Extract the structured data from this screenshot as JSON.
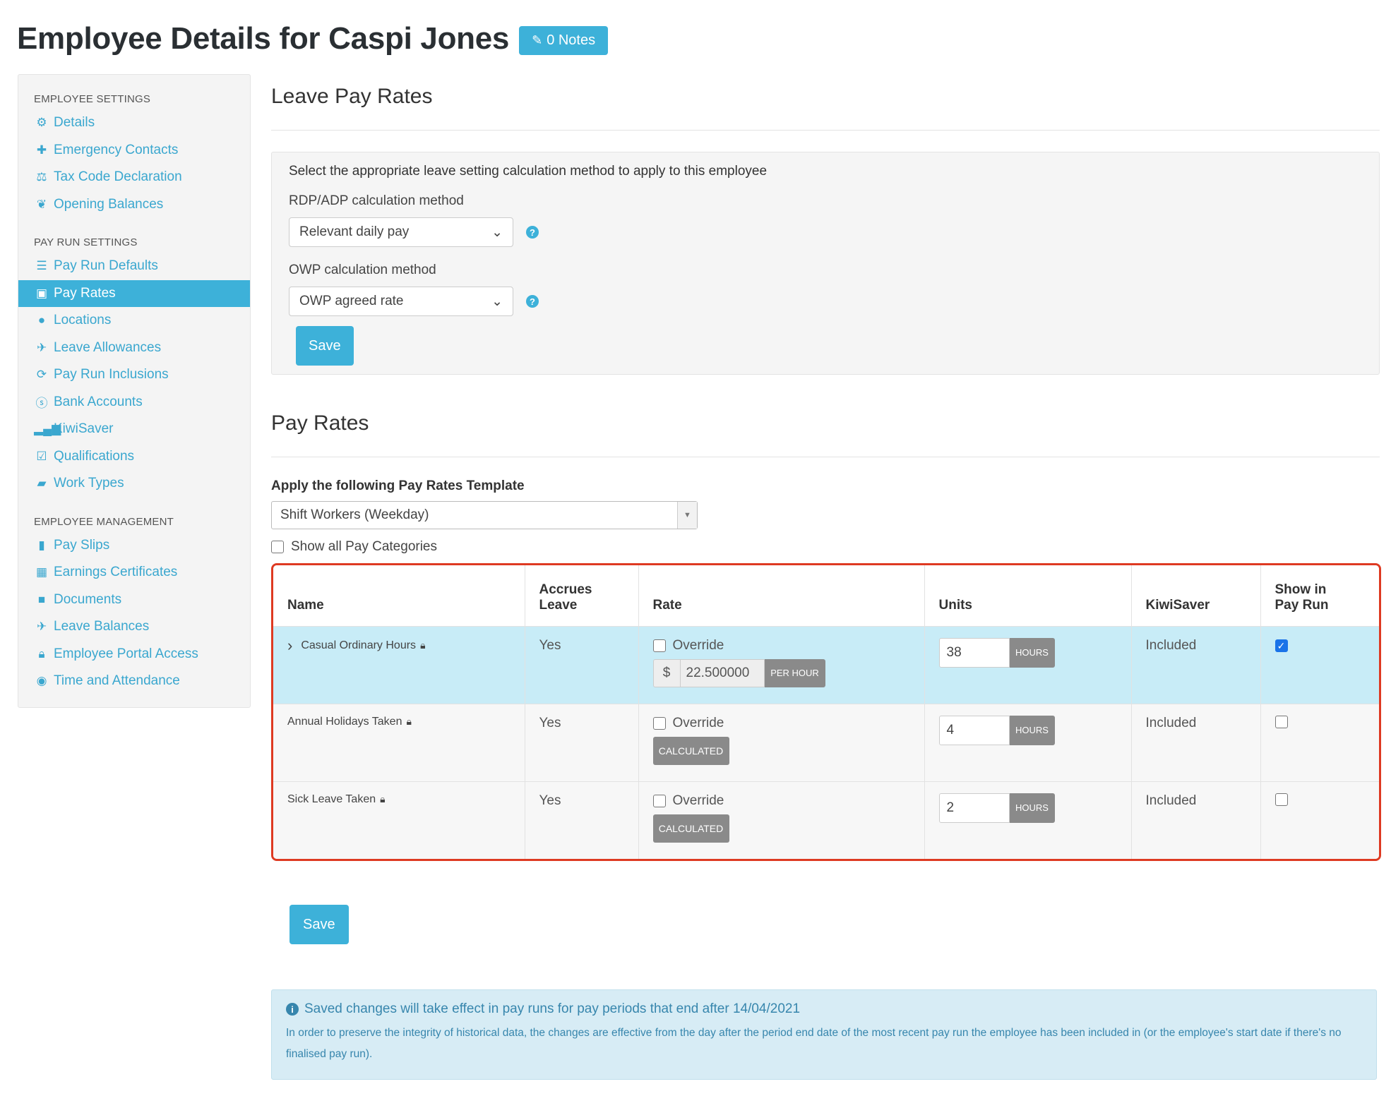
{
  "header": {
    "title": "Employee Details for Caspi Jones",
    "notes_label": "0 Notes"
  },
  "sidebar": {
    "sections": [
      {
        "title": "EMPLOYEE SETTINGS",
        "items": [
          {
            "label": "Details",
            "icon": "gear-icon"
          },
          {
            "label": "Emergency Contacts",
            "icon": "plus-icon"
          },
          {
            "label": "Tax Code Declaration",
            "icon": "scale-icon"
          },
          {
            "label": "Opening Balances",
            "icon": "leaf-icon"
          }
        ]
      },
      {
        "title": "PAY RUN SETTINGS",
        "items": [
          {
            "label": "Pay Run Defaults",
            "icon": "list-icon"
          },
          {
            "label": "Pay Rates",
            "icon": "money-icon",
            "active": true
          },
          {
            "label": "Locations",
            "icon": "globe-icon"
          },
          {
            "label": "Leave Allowances",
            "icon": "plane-icon"
          },
          {
            "label": "Pay Run Inclusions",
            "icon": "refresh-icon"
          },
          {
            "label": "Bank Accounts",
            "icon": "dollar-circle-icon"
          },
          {
            "label": "KiwiSaver",
            "icon": "signal-icon"
          },
          {
            "label": "Qualifications",
            "icon": "check-square-icon"
          },
          {
            "label": "Work Types",
            "icon": "book-icon"
          }
        ]
      },
      {
        "title": "EMPLOYEE MANAGEMENT",
        "items": [
          {
            "label": "Pay Slips",
            "icon": "file-icon"
          },
          {
            "label": "Earnings Certificates",
            "icon": "calculator-icon"
          },
          {
            "label": "Documents",
            "icon": "folder-icon"
          },
          {
            "label": "Leave Balances",
            "icon": "plane-icon"
          },
          {
            "label": "Employee Portal Access",
            "icon": "lock-icon"
          },
          {
            "label": "Time and Attendance",
            "icon": "clock-person-icon"
          }
        ]
      }
    ]
  },
  "leave": {
    "title": "Leave Pay Rates",
    "intro": "Select the appropriate leave setting calculation method to apply to this employee",
    "rdp_label": "RDP/ADP calculation method",
    "rdp_value": "Relevant daily pay",
    "owp_label": "OWP calculation method",
    "owp_value": "OWP agreed rate",
    "save_label": "Save"
  },
  "payrates": {
    "title": "Pay Rates",
    "apply_label": "Apply the following Pay Rates Template",
    "template_value": "Shift Workers (Weekday)",
    "show_all_label": "Show all Pay Categories",
    "columns": {
      "name": "Name",
      "accrues_1": "Accrues",
      "accrues_2": "Leave",
      "rate": "Rate",
      "units": "Units",
      "kiwisaver": "KiwiSaver",
      "show_1": "Show in",
      "show_2": "Pay Run"
    },
    "rows": [
      {
        "name": "Casual Ordinary Hours",
        "accrues": "Yes",
        "override": "Override",
        "rate_prefix": "$",
        "rate": "22.500000",
        "rate_suffix": "PER HOUR",
        "units": "38",
        "units_suffix": "HOURS",
        "kiwisaver": "Included",
        "show": true
      },
      {
        "name": "Annual Holidays Taken",
        "accrues": "Yes",
        "override": "Override",
        "calculated": "CALCULATED",
        "units": "4",
        "units_suffix": "HOURS",
        "kiwisaver": "Included",
        "show": false
      },
      {
        "name": "Sick Leave Taken",
        "accrues": "Yes",
        "override": "Override",
        "calculated": "CALCULATED",
        "units": "2",
        "units_suffix": "HOURS",
        "kiwisaver": "Included",
        "show": false
      }
    ],
    "save_label": "Save"
  },
  "info": {
    "title": "Saved changes will take effect in pay runs for pay periods that end after 14/04/2021",
    "body": "In order to preserve the integrity of historical data, the changes are effective from the day after the period end date of the most recent pay run the employee has been included in (or the employee's start date if there's no finalised pay run)."
  }
}
